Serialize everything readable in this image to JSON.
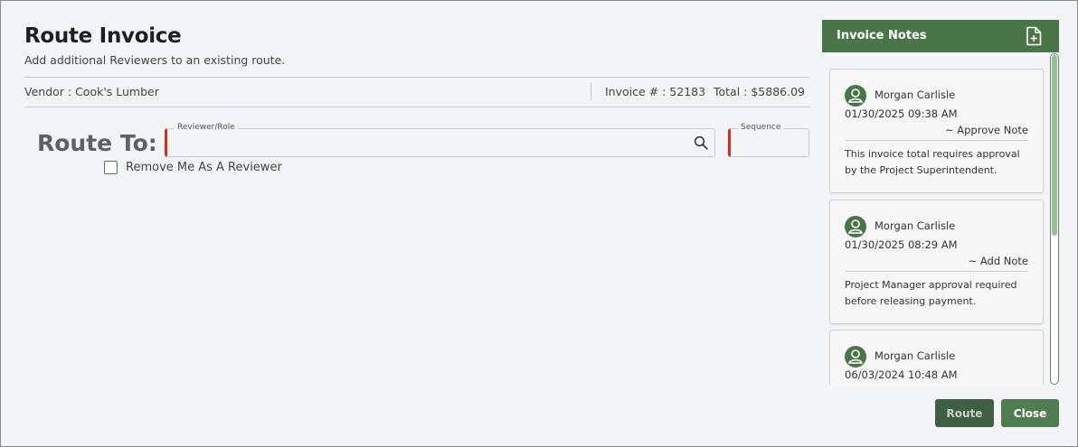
{
  "dialog": {
    "title": "Route Invoice",
    "subtitle": "Add additional Reviewers to an existing route.",
    "vendor": "Vendor : Cook's Lumber",
    "invoice_number": "Invoice # : 52183",
    "total": "Total : $5886.09"
  },
  "route": {
    "route_to_label": "Route To:",
    "reviewer_label": "Reviewer/Role",
    "reviewer_value": "",
    "sequence_label": "Sequence",
    "sequence_value": "",
    "remove_me_label": "Remove Me As A Reviewer",
    "remove_me_checked": false
  },
  "notes": {
    "header": "Invoice Notes",
    "items": [
      {
        "author": "Morgan Carlisle",
        "date": "01/30/2025 09:38 AM",
        "type": "~ Approve Note",
        "text": "This invoice total requires approval by the Project Superintendent."
      },
      {
        "author": "Morgan Carlisle",
        "date": "01/30/2025 08:29 AM",
        "type": "~ Add Note",
        "text": "Project Manager approval required before releasing payment."
      },
      {
        "author": "Morgan Carlisle",
        "date": "06/03/2024 10:48 AM",
        "type": "",
        "text": ""
      }
    ]
  },
  "buttons": {
    "route": "Route",
    "close": "Close"
  },
  "colors": {
    "accent_green": "#4a7549",
    "required_red": "#d62b1f",
    "scroll_thumb": "#93c393"
  },
  "icons": {
    "add_note": "file-plus-icon",
    "search": "search-icon",
    "avatar": "user-icon"
  }
}
